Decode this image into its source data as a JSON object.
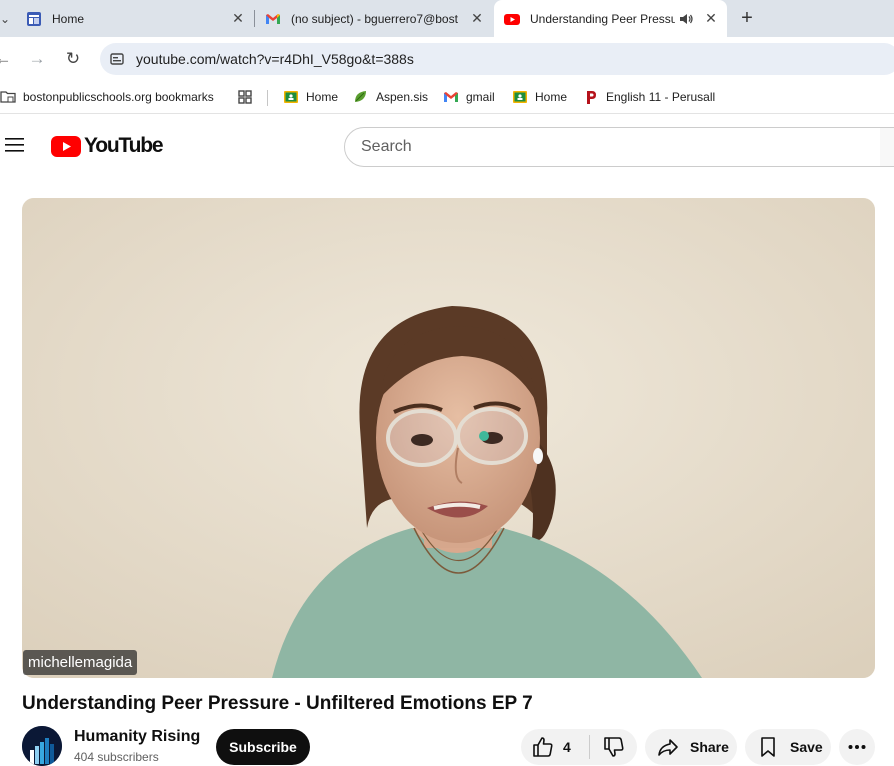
{
  "tabs": [
    {
      "title": "Home",
      "icon": "google-sites-icon",
      "active": false
    },
    {
      "title": "(no subject) - bguerrero7@bost",
      "icon": "gmail-icon",
      "active": false
    },
    {
      "title": "Understanding Peer Pressu",
      "icon": "youtube-icon",
      "active": true,
      "audio": "speaker-icon"
    }
  ],
  "omnibox": {
    "url": "youtube.com/watch?v=r4DhI_V58go&t=388s"
  },
  "bookmarks": [
    {
      "label": "bostonpublicschools.org bookmarks",
      "icon": "managed-folder-icon"
    },
    {
      "label": "Home",
      "icon": "classroom-icon"
    },
    {
      "label": "Aspen.sis",
      "icon": "aspen-leaf-icon"
    },
    {
      "label": "gmail",
      "icon": "gmail-icon"
    },
    {
      "label": "Home",
      "icon": "classroom-icon"
    },
    {
      "label": "English 11 - Perusall",
      "icon": "perusall-icon"
    }
  ],
  "youtube": {
    "logo_text": "YouTube",
    "search_placeholder": "Search"
  },
  "video": {
    "overlay_name": "michellemagida",
    "title": "Understanding Peer Pressure - Unfiltered Emotions EP 7"
  },
  "channel": {
    "name": "Humanity Rising",
    "subscribers": "404 subscribers",
    "subscribe_label": "Subscribe"
  },
  "actions": {
    "like_count": "4",
    "share_label": "Share",
    "save_label": "Save"
  },
  "colors": {
    "youtube_red": "#ff0000",
    "tabstrip": "#dde3ea",
    "omnibox": "#e9eef6"
  }
}
